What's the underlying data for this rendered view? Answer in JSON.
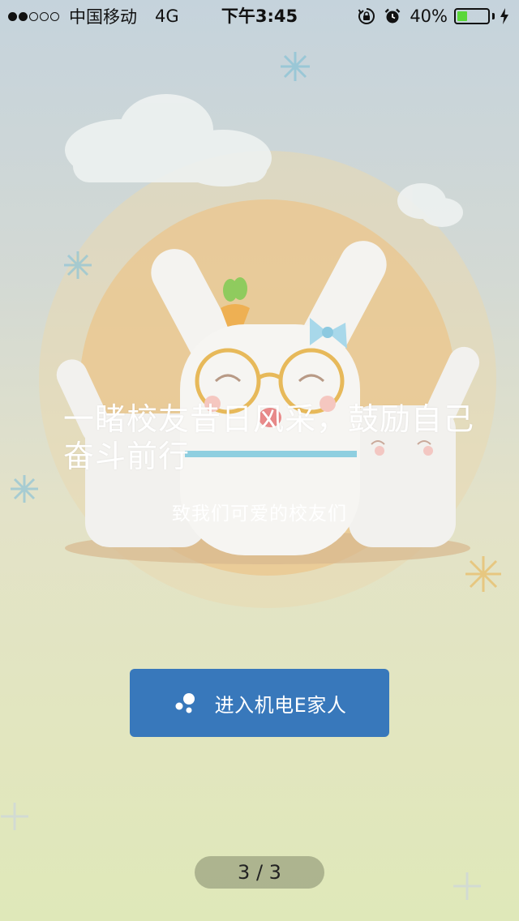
{
  "status_bar": {
    "carrier": "中国移动",
    "network": "4G",
    "time": "下午3:45",
    "battery_percent_text": "40%",
    "battery_level": 0.4,
    "signal_strength": 2,
    "signal_total": 5,
    "icons": [
      "signal-dots-icon",
      "orientation-lock-icon",
      "alarm-clock-icon",
      "battery-icon",
      "charging-bolt-icon"
    ]
  },
  "intro": {
    "headline": "一睹校友昔日风采，鼓励自己奋斗前行",
    "subtitle": "致我们可爱的校友们"
  },
  "enter_button": {
    "label": "进入机电E家人",
    "icon": "bubbles-icon",
    "color": "#3878bb"
  },
  "pager": {
    "text": "3 / 3",
    "current": 3,
    "total": 3
  }
}
